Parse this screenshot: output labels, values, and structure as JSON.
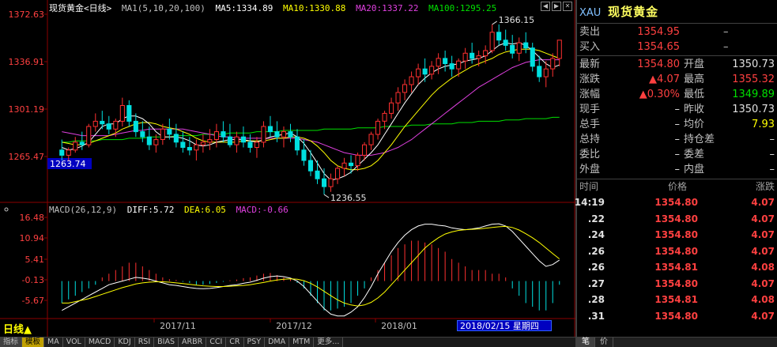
{
  "chart": {
    "title": "现货黄金<日线>",
    "ma_legend": {
      "params": "MA1(5,10,20,100)",
      "ma5": "MA5:1334.89",
      "ma10": "MA10:1330.88",
      "ma20": "MA20:1337.22",
      "ma100": "MA100:1295.25"
    },
    "price_axis_labels": [
      "1372.63",
      "1336.91",
      "1301.19",
      "1265.47"
    ],
    "current_price_tag": "1263.74",
    "high_label": "1366.15",
    "low_label": "1236.55",
    "macd_legend": {
      "params": "MACD(26,12,9)",
      "diff": "DIFF:5.72",
      "dea": "DEA:6.05",
      "macd": "MACD:-0.66"
    },
    "macd_axis_labels": [
      "16.48",
      "10.94",
      "5.41",
      "-0.13",
      "-5.67"
    ],
    "date_labels": [
      "2017/11",
      "2017/12",
      "2018/01"
    ],
    "period": "日线▲",
    "cursor_date": "2018/02/15 星期四",
    "colors": {
      "up": "#ff3030",
      "down": "#00e0e0",
      "ma5": "#ffffff",
      "ma10": "#ffff00",
      "ma20": "#e040e0",
      "ma100": "#00e000",
      "macd_up": "#ff3030",
      "macd_down": "#00e0e0"
    }
  },
  "chart_data": {
    "type": "candlestick",
    "title": "现货黄金<日线>",
    "ylim": [
      1230,
      1375
    ],
    "macd_ylim": [
      -10,
      18
    ],
    "candles": [
      [
        1270,
        1278,
        1262,
        1266
      ],
      [
        1266,
        1272,
        1262,
        1270
      ],
      [
        1270,
        1280,
        1268,
        1276
      ],
      [
        1276,
        1284,
        1270,
        1274
      ],
      [
        1274,
        1290,
        1272,
        1288
      ],
      [
        1288,
        1298,
        1284,
        1292
      ],
      [
        1292,
        1300,
        1286,
        1290
      ],
      [
        1290,
        1296,
        1282,
        1286
      ],
      [
        1286,
        1294,
        1280,
        1292
      ],
      [
        1292,
        1310,
        1288,
        1304
      ],
      [
        1304,
        1308,
        1288,
        1292
      ],
      [
        1292,
        1298,
        1280,
        1284
      ],
      [
        1284,
        1292,
        1276,
        1280
      ],
      [
        1280,
        1288,
        1270,
        1274
      ],
      [
        1274,
        1282,
        1268,
        1278
      ],
      [
        1278,
        1290,
        1274,
        1286
      ],
      [
        1286,
        1294,
        1278,
        1282
      ],
      [
        1282,
        1290,
        1272,
        1276
      ],
      [
        1276,
        1284,
        1268,
        1272
      ],
      [
        1272,
        1280,
        1266,
        1270
      ],
      [
        1270,
        1278,
        1262,
        1274
      ],
      [
        1274,
        1282,
        1268,
        1276
      ],
      [
        1276,
        1286,
        1270,
        1278
      ],
      [
        1278,
        1290,
        1272,
        1284
      ],
      [
        1284,
        1292,
        1276,
        1280
      ],
      [
        1280,
        1290,
        1272,
        1274
      ],
      [
        1274,
        1284,
        1268,
        1280
      ],
      [
        1280,
        1288,
        1272,
        1276
      ],
      [
        1276,
        1282,
        1268,
        1272
      ],
      [
        1272,
        1280,
        1264,
        1276
      ],
      [
        1276,
        1292,
        1272,
        1288
      ],
      [
        1288,
        1296,
        1280,
        1284
      ],
      [
        1284,
        1292,
        1276,
        1280
      ],
      [
        1280,
        1288,
        1272,
        1284
      ],
      [
        1284,
        1290,
        1276,
        1280
      ],
      [
        1280,
        1286,
        1266,
        1270
      ],
      [
        1270,
        1278,
        1258,
        1262
      ],
      [
        1262,
        1270,
        1250,
        1254
      ],
      [
        1254,
        1262,
        1244,
        1248
      ],
      [
        1248,
        1256,
        1236,
        1242
      ],
      [
        1242,
        1252,
        1238,
        1248
      ],
      [
        1248,
        1258,
        1244,
        1256
      ],
      [
        1256,
        1264,
        1250,
        1260
      ],
      [
        1260,
        1266,
        1252,
        1258
      ],
      [
        1258,
        1268,
        1254,
        1266
      ],
      [
        1266,
        1276,
        1262,
        1274
      ],
      [
        1274,
        1284,
        1270,
        1282
      ],
      [
        1282,
        1294,
        1278,
        1292
      ],
      [
        1292,
        1300,
        1286,
        1298
      ],
      [
        1298,
        1310,
        1294,
        1306
      ],
      [
        1306,
        1318,
        1300,
        1314
      ],
      [
        1314,
        1324,
        1308,
        1320
      ],
      [
        1320,
        1330,
        1314,
        1326
      ],
      [
        1326,
        1336,
        1320,
        1332
      ],
      [
        1332,
        1340,
        1322,
        1328
      ],
      [
        1328,
        1338,
        1324,
        1334
      ],
      [
        1334,
        1344,
        1328,
        1340
      ],
      [
        1340,
        1346,
        1330,
        1336
      ],
      [
        1336,
        1342,
        1326,
        1332
      ],
      [
        1332,
        1340,
        1326,
        1338
      ],
      [
        1338,
        1348,
        1332,
        1344
      ],
      [
        1344,
        1352,
        1336,
        1340
      ],
      [
        1340,
        1346,
        1334,
        1342
      ],
      [
        1342,
        1350,
        1336,
        1346
      ],
      [
        1346,
        1366,
        1344,
        1360
      ],
      [
        1360,
        1366,
        1350,
        1354
      ],
      [
        1354,
        1362,
        1346,
        1350
      ],
      [
        1350,
        1358,
        1340,
        1344
      ],
      [
        1344,
        1356,
        1338,
        1352
      ],
      [
        1352,
        1360,
        1344,
        1348
      ],
      [
        1348,
        1352,
        1330,
        1334
      ],
      [
        1334,
        1342,
        1322,
        1326
      ],
      [
        1326,
        1338,
        1318,
        1332
      ],
      [
        1332,
        1344,
        1326,
        1340
      ],
      [
        1340,
        1350,
        1334,
        1354
      ]
    ],
    "ma5": [
      1272,
      1270,
      1271,
      1273,
      1276,
      1282,
      1288,
      1290,
      1290,
      1294,
      1296,
      1296,
      1294,
      1290,
      1284,
      1280,
      1280,
      1280,
      1279,
      1277,
      1274,
      1273,
      1274,
      1276,
      1277,
      1278,
      1278,
      1278,
      1277,
      1276,
      1278,
      1280,
      1281,
      1282,
      1283,
      1280,
      1275,
      1268,
      1260,
      1252,
      1247,
      1248,
      1250,
      1253,
      1258,
      1263,
      1268,
      1274,
      1282,
      1290,
      1298,
      1306,
      1313,
      1320,
      1325,
      1329,
      1332,
      1334,
      1335,
      1336,
      1338,
      1339,
      1340,
      1342,
      1346,
      1350,
      1352,
      1351,
      1352,
      1350,
      1346,
      1341,
      1336,
      1333,
      1335
    ],
    "ma10": [
      1276,
      1275,
      1274,
      1274,
      1275,
      1277,
      1279,
      1281,
      1283,
      1286,
      1288,
      1290,
      1291,
      1291,
      1290,
      1288,
      1287,
      1286,
      1284,
      1282,
      1279,
      1277,
      1276,
      1276,
      1276,
      1276,
      1276,
      1277,
      1277,
      1277,
      1277,
      1278,
      1279,
      1279,
      1280,
      1280,
      1279,
      1277,
      1273,
      1268,
      1262,
      1258,
      1256,
      1255,
      1255,
      1256,
      1258,
      1262,
      1268,
      1274,
      1281,
      1288,
      1294,
      1300,
      1306,
      1312,
      1317,
      1321,
      1325,
      1328,
      1331,
      1334,
      1336,
      1338,
      1340,
      1343,
      1345,
      1346,
      1347,
      1347,
      1347,
      1346,
      1344,
      1342,
      1340
    ],
    "ma20": [
      1284,
      1283,
      1282,
      1281,
      1281,
      1281,
      1281,
      1281,
      1282,
      1283,
      1284,
      1285,
      1285,
      1286,
      1286,
      1286,
      1286,
      1286,
      1286,
      1285,
      1284,
      1283,
      1282,
      1281,
      1280,
      1280,
      1279,
      1279,
      1279,
      1279,
      1279,
      1279,
      1279,
      1279,
      1279,
      1279,
      1278,
      1277,
      1276,
      1274,
      1272,
      1270,
      1268,
      1267,
      1266,
      1266,
      1266,
      1267,
      1268,
      1270,
      1272,
      1275,
      1278,
      1282,
      1286,
      1290,
      1294,
      1298,
      1302,
      1306,
      1310,
      1314,
      1318,
      1321,
      1324,
      1327,
      1330,
      1333,
      1335,
      1337,
      1338,
      1339,
      1339,
      1339,
      1339
    ],
    "ma100": [
      1276,
      1276,
      1277,
      1277,
      1277,
      1277,
      1278,
      1278,
      1278,
      1278,
      1279,
      1279,
      1279,
      1280,
      1280,
      1280,
      1280,
      1281,
      1281,
      1281,
      1281,
      1282,
      1282,
      1282,
      1282,
      1283,
      1283,
      1283,
      1283,
      1284,
      1284,
      1284,
      1284,
      1285,
      1285,
      1285,
      1285,
      1285,
      1285,
      1286,
      1286,
      1286,
      1286,
      1286,
      1287,
      1287,
      1287,
      1287,
      1288,
      1288,
      1288,
      1288,
      1289,
      1289,
      1289,
      1290,
      1290,
      1290,
      1290,
      1291,
      1291,
      1291,
      1292,
      1292,
      1292,
      1292,
      1293,
      1293,
      1293,
      1294,
      1294,
      1294,
      1294,
      1295,
      1295
    ],
    "macd": [
      -6,
      -5,
      -4,
      -3,
      -2,
      -1,
      1,
      2,
      3,
      4,
      5,
      5,
      4,
      3,
      2,
      1,
      0.5,
      0.3,
      -0.2,
      -0.5,
      -1,
      -1,
      -0.8,
      -0.5,
      -0.2,
      0.2,
      0.4,
      0.8,
      1,
      1.5,
      2,
      2.2,
      1.6,
      1,
      0.5,
      -0.5,
      -2,
      -4,
      -6,
      -8,
      -8,
      -7.5,
      -7,
      -6,
      -4,
      -2,
      1,
      3,
      5,
      7,
      9,
      10,
      11,
      11,
      10.5,
      10,
      9,
      8,
      6,
      5,
      4,
      3,
      3,
      3,
      2,
      2,
      1,
      -2,
      -4,
      -6,
      -7,
      -8,
      -8,
      -6,
      -1
    ],
    "diff": [
      -8,
      -7,
      -6,
      -5,
      -4,
      -3,
      -2,
      -1,
      -0.5,
      0,
      0.5,
      1,
      0.8,
      0.5,
      0,
      -0.5,
      -1,
      -1.2,
      -1.5,
      -1.8,
      -2,
      -2.1,
      -2,
      -1.8,
      -1.5,
      -1.2,
      -1,
      -0.6,
      -0.3,
      0.2,
      0.8,
      1.2,
      1.4,
      1.2,
      0.8,
      0,
      -1.5,
      -3.5,
      -5.5,
      -7.5,
      -9,
      -9.5,
      -9.5,
      -8.5,
      -7,
      -4.5,
      -1.5,
      2,
      5,
      8,
      10.5,
      12.5,
      14,
      15,
      15.5,
      15.5,
      15.2,
      15,
      14.5,
      14.2,
      14,
      14.2,
      14.5,
      15,
      15.5,
      15.6,
      15,
      13.5,
      11.5,
      9.5,
      7.5,
      5.5,
      4,
      4.5,
      5.7
    ],
    "dea": [
      -6,
      -6,
      -5.6,
      -5.2,
      -4.8,
      -4.2,
      -3.6,
      -3,
      -2.4,
      -1.8,
      -1.3,
      -0.8,
      -0.5,
      -0.3,
      -0.2,
      -0.2,
      -0.3,
      -0.5,
      -0.7,
      -0.9,
      -1.1,
      -1.3,
      -1.4,
      -1.5,
      -1.5,
      -1.4,
      -1.3,
      -1.2,
      -1,
      -0.7,
      -0.4,
      0,
      0.3,
      0.5,
      0.6,
      0.5,
      0.1,
      -0.6,
      -1.6,
      -2.8,
      -4,
      -5.1,
      -6,
      -6.5,
      -6.8,
      -6.5,
      -5.8,
      -4.6,
      -3,
      -1,
      1,
      3,
      5,
      7,
      9,
      10.5,
      11.8,
      12.8,
      13.4,
      13.8,
      14,
      14.1,
      14.2,
      14.4,
      14.6,
      14.8,
      14.9,
      14.6,
      13.9,
      12.9,
      11.8,
      10.5,
      9,
      7.5,
      6.05
    ]
  },
  "quote": {
    "symbol": "XAU",
    "name": "现货黄金",
    "sell_label": "卖出",
    "sell_price": "1354.95",
    "sell_vol": "–",
    "buy_label": "买入",
    "buy_price": "1354.65",
    "buy_vol": "–",
    "rows": [
      {
        "l1": "最新",
        "v1": "1354.80",
        "c1": "red",
        "l2": "开盘",
        "v2": "1350.73",
        "c2": "white"
      },
      {
        "l1": "涨跌",
        "v1": "▲4.07",
        "c1": "red",
        "l2": "最高",
        "v2": "1355.32",
        "c2": "red"
      },
      {
        "l1": "涨幅",
        "v1": "▲0.30%",
        "c1": "red",
        "l2": "最低",
        "v2": "1349.89",
        "c2": "green"
      },
      {
        "l1": "现手",
        "v1": "–",
        "c1": "white",
        "l2": "昨收",
        "v2": "1350.73",
        "c2": "white"
      },
      {
        "l1": "总手",
        "v1": "–",
        "c1": "white",
        "l2": "均价",
        "v2": "7.93",
        "c2": "yellow"
      },
      {
        "l1": "总持",
        "v1": "–",
        "c1": "white",
        "l2": "持仓差",
        "v2": "–",
        "c2": "white"
      },
      {
        "l1": "委比",
        "v1": "–",
        "c1": "white",
        "l2": "委差",
        "v2": "–",
        "c2": "white"
      },
      {
        "l1": "外盘",
        "v1": "–",
        "c1": "white",
        "l2": "内盘",
        "v2": "–",
        "c2": "white"
      }
    ],
    "ticks_header": {
      "time": "时间",
      "price": "价格",
      "change": "涨跌"
    },
    "ticks": [
      {
        "time": "14:19",
        "price": "1354.80",
        "change": "4.07"
      },
      {
        "time": ".22",
        "price": "1354.80",
        "change": "4.07"
      },
      {
        "time": ".24",
        "price": "1354.80",
        "change": "4.07"
      },
      {
        "time": ".26",
        "price": "1354.80",
        "change": "4.07"
      },
      {
        "time": ".26",
        "price": "1354.81",
        "change": "4.08"
      },
      {
        "time": ".27",
        "price": "1354.80",
        "change": "4.07"
      },
      {
        "time": ".28",
        "price": "1354.81",
        "change": "4.08"
      },
      {
        "time": ".31",
        "price": "1354.80",
        "change": "4.07"
      }
    ],
    "bottom_tabs": [
      "笔",
      "价"
    ]
  },
  "bottom_tabs": [
    "指标",
    "模板",
    "MA",
    "VOL",
    "MACD",
    "KDJ",
    "RSI",
    "BIAS",
    "ARBR",
    "CCI",
    "CR",
    "PSY",
    "DMA",
    "MTM",
    "更多..."
  ]
}
